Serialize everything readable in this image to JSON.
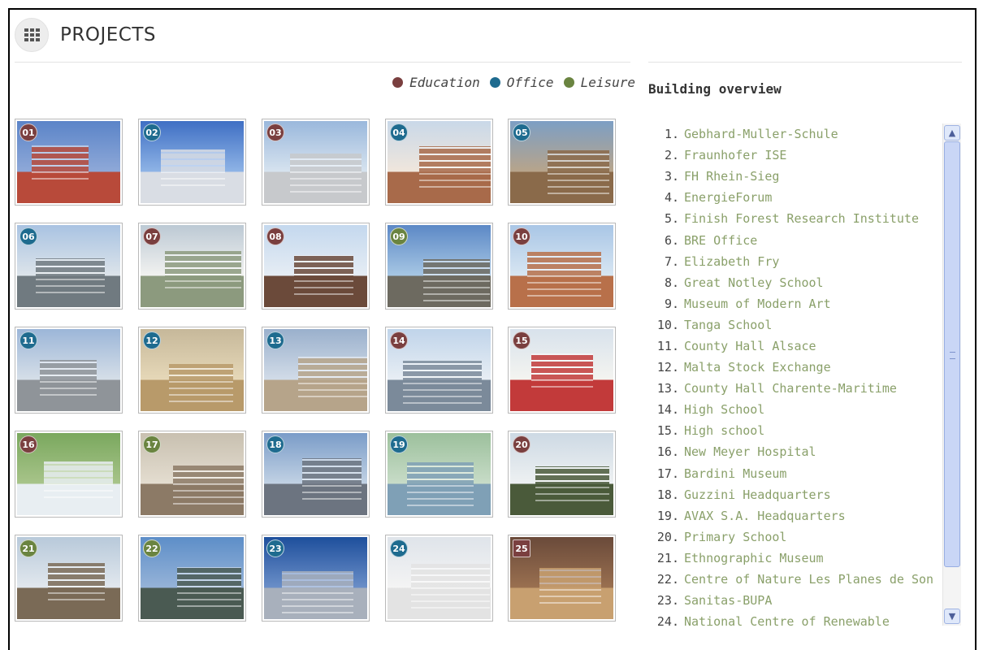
{
  "header": {
    "title": "PROJECTS",
    "icon": "grid-icon"
  },
  "legend": [
    {
      "label": "Education",
      "color": "#7a3f3f"
    },
    {
      "label": "Office",
      "color": "#1e6b8f"
    },
    {
      "label": "Leisure",
      "color": "#6a8440"
    }
  ],
  "overview": {
    "title": "Building overview"
  },
  "tiles": [
    {
      "num": "01",
      "cat": "Education"
    },
    {
      "num": "02",
      "cat": "Office"
    },
    {
      "num": "03",
      "cat": "Education"
    },
    {
      "num": "04",
      "cat": "Office"
    },
    {
      "num": "05",
      "cat": "Office"
    },
    {
      "num": "06",
      "cat": "Office"
    },
    {
      "num": "07",
      "cat": "Education"
    },
    {
      "num": "08",
      "cat": "Education"
    },
    {
      "num": "09",
      "cat": "Leisure"
    },
    {
      "num": "10",
      "cat": "Education"
    },
    {
      "num": "11",
      "cat": "Office"
    },
    {
      "num": "12",
      "cat": "Office"
    },
    {
      "num": "13",
      "cat": "Office"
    },
    {
      "num": "14",
      "cat": "Education"
    },
    {
      "num": "15",
      "cat": "Education"
    },
    {
      "num": "16",
      "cat": "Education"
    },
    {
      "num": "17",
      "cat": "Leisure"
    },
    {
      "num": "18",
      "cat": "Office"
    },
    {
      "num": "19",
      "cat": "Office"
    },
    {
      "num": "20",
      "cat": "Education"
    },
    {
      "num": "21",
      "cat": "Leisure"
    },
    {
      "num": "22",
      "cat": "Leisure"
    },
    {
      "num": "23",
      "cat": "Office"
    },
    {
      "num": "24",
      "cat": "Office"
    },
    {
      "num": "25",
      "cat": "Education"
    }
  ],
  "buildings": [
    {
      "n": "1.",
      "name": "Gebhard-Muller-Schule"
    },
    {
      "n": "2.",
      "name": "Fraunhofer ISE"
    },
    {
      "n": "3.",
      "name": "FH Rhein-Sieg"
    },
    {
      "n": "4.",
      "name": "EnergieForum"
    },
    {
      "n": "5.",
      "name": "Finish Forest Research Institute"
    },
    {
      "n": "6.",
      "name": "BRE Office"
    },
    {
      "n": "7.",
      "name": "Elizabeth Fry"
    },
    {
      "n": "8.",
      "name": "Great Notley School"
    },
    {
      "n": "9.",
      "name": "Museum of Modern Art"
    },
    {
      "n": "10.",
      "name": "Tanga School"
    },
    {
      "n": "11.",
      "name": "County Hall Alsace"
    },
    {
      "n": "12.",
      "name": "Malta Stock Exchange"
    },
    {
      "n": "13.",
      "name": "County Hall Charente-Maritime"
    },
    {
      "n": "14.",
      "name": "High School"
    },
    {
      "n": "15.",
      "name": "High school"
    },
    {
      "n": "16.",
      "name": "New Meyer Hospital"
    },
    {
      "n": "17.",
      "name": "Bardini Museum"
    },
    {
      "n": "18.",
      "name": "Guzzini Headquarters"
    },
    {
      "n": "19.",
      "name": "AVAX S.A. Headquarters"
    },
    {
      "n": "20.",
      "name": "Primary School"
    },
    {
      "n": "21.",
      "name": "Ethnographic Museum"
    },
    {
      "n": "22.",
      "name": "Centre of Nature Les Planes de Son"
    },
    {
      "n": "23.",
      "name": "Sanitas-BUPA"
    },
    {
      "n": "24.",
      "name": "National Centre of Renewable"
    }
  ],
  "colors": {
    "link": "#8aa06a",
    "education": "#7a3f3f",
    "office": "#1e6b8f",
    "leisure": "#6a8440"
  }
}
